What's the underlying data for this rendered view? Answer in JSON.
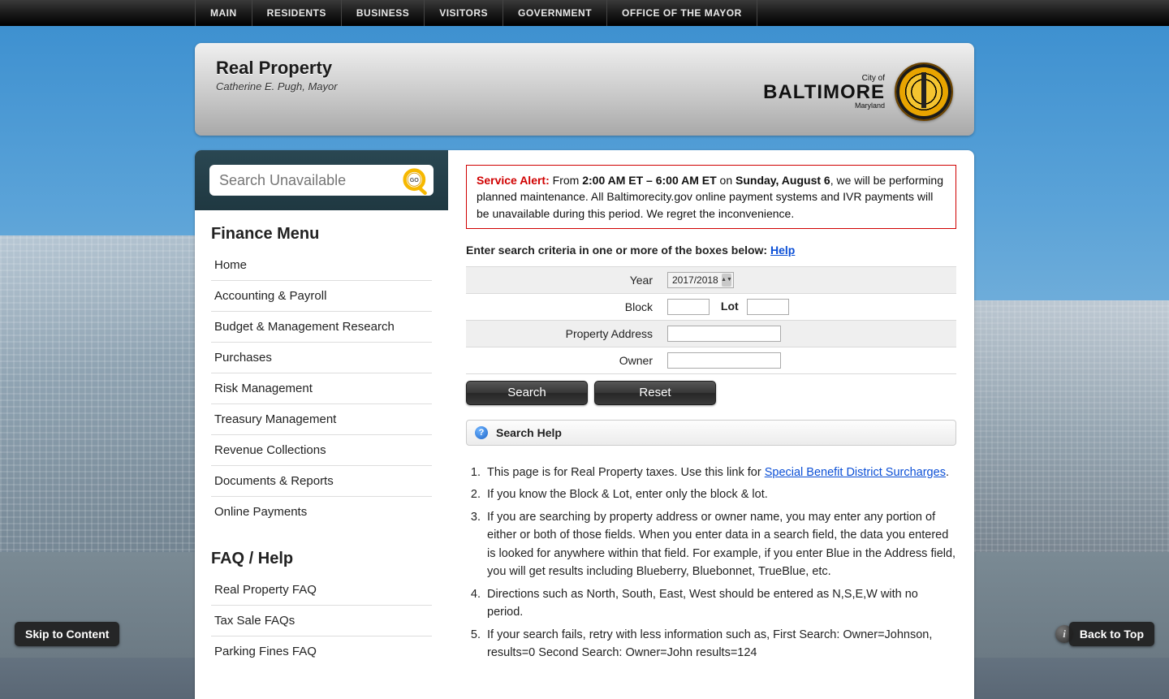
{
  "nav": {
    "items": [
      "MAIN",
      "RESIDENTS",
      "BUSINESS",
      "VISITORS",
      "GOVERNMENT",
      "OFFICE OF THE MAYOR"
    ]
  },
  "header": {
    "title": "Real Property",
    "subtitle": "Catherine E. Pugh, Mayor",
    "city_line1": "City of",
    "city_line2": "BALTIMORE",
    "city_line3": "Maryland"
  },
  "search": {
    "placeholder": "Search Unavailable",
    "go_label": "GO"
  },
  "sidebar": {
    "heading1": "Finance Menu",
    "menu1": [
      "Home",
      "Accounting & Payroll",
      "Budget & Management Research",
      "Purchases",
      "Risk Management",
      "Treasury Management",
      "Revenue Collections",
      "Documents & Reports",
      "Online Payments"
    ],
    "heading2": "FAQ / Help",
    "menu2": [
      "Real Property FAQ",
      "Tax Sale FAQs",
      "Parking Fines FAQ"
    ]
  },
  "alert": {
    "label": "Service Alert:",
    "pre": " From ",
    "time": "2:00 AM ET – 6:00 AM ET",
    "mid": " on ",
    "date": "Sunday, August 6",
    "rest": ", we will be performing planned maintenance. All Baltimorecity.gov online payment systems and IVR payments will be unavailable during this period. We regret the inconvenience."
  },
  "criteria": {
    "text": "Enter search criteria in one or more of the boxes below: ",
    "help_link": "Help"
  },
  "form": {
    "year_label": "Year",
    "year_value": "2017/2018",
    "block_label": "Block",
    "lot_label": "Lot",
    "address_label": "Property Address",
    "owner_label": "Owner",
    "search_btn": "Search",
    "reset_btn": "Reset"
  },
  "help_band": "Search Help",
  "help_items": {
    "i1a": "This page is for Real Property taxes. Use this link for ",
    "i1_link": "Special Benefit District Surcharges",
    "i1b": ".",
    "i2": "If you know the Block & Lot, enter only the block & lot.",
    "i3": "If you are searching by property address or owner name, you may enter any portion of either or both of those fields. When you enter data in a search field, the data you entered is looked for anywhere within that field. For example, if you enter Blue in the Address field, you will get results including Blueberry, Bluebonnet, TrueBlue, etc.",
    "i4": "Directions such as North, South, East, West should be entered as N,S,E,W with no period.",
    "i5": "If your search fails, retry with less information such as, First Search: Owner=Johnson, results=0 Second Search: Owner=John results=124"
  },
  "footer": {
    "skip": "Skip to Content",
    "back": "Back to Top"
  }
}
